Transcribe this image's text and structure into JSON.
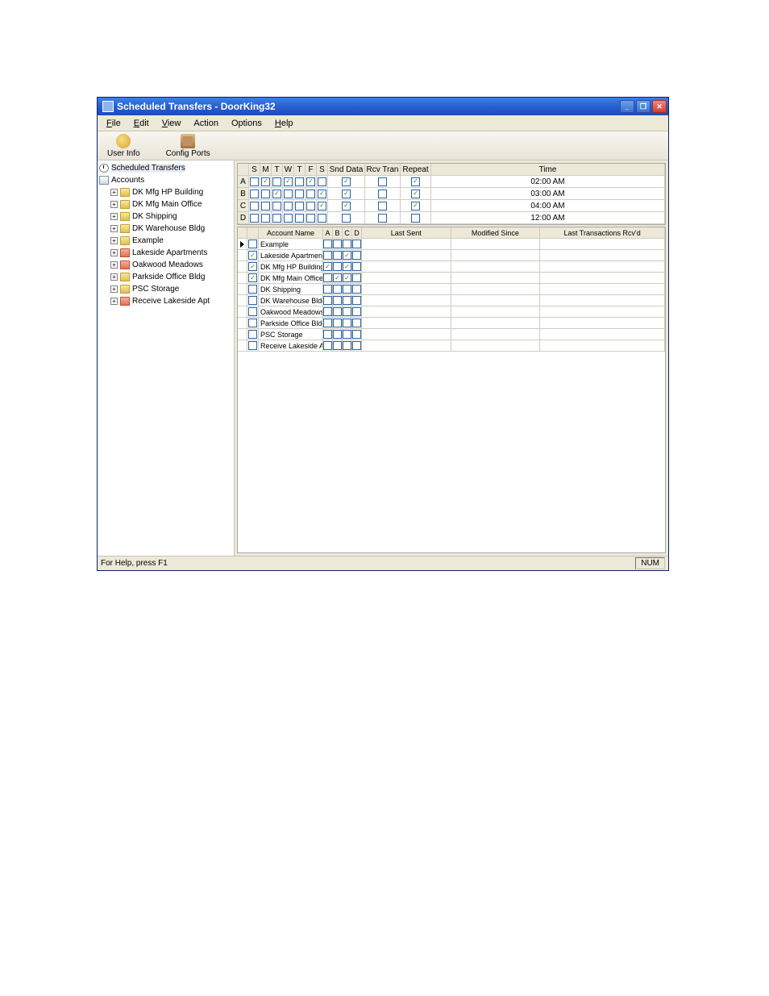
{
  "title": "Scheduled Transfers  - DoorKing32",
  "menu": [
    "File",
    "Edit",
    "View",
    "Action",
    "Options",
    "Help"
  ],
  "toolbar": {
    "userinfo": "User Info",
    "config": "Config Ports"
  },
  "tree": {
    "root1": "Scheduled Transfers",
    "root2": "Accounts",
    "items": [
      {
        "label": "DK Mfg HP Building",
        "color": "y"
      },
      {
        "label": "DK Mfg Main Office",
        "color": "y"
      },
      {
        "label": "DK Shipping",
        "color": "y"
      },
      {
        "label": "DK Warehouse Bldg",
        "color": "y"
      },
      {
        "label": "Example",
        "color": "y"
      },
      {
        "label": "Lakeside Apartments",
        "color": "r"
      },
      {
        "label": "Oakwood Meadows",
        "color": "r"
      },
      {
        "label": "Parkside Office Bldg",
        "color": "y"
      },
      {
        "label": "PSC Storage",
        "color": "y"
      },
      {
        "label": "Receive Lakeside Apt",
        "color": "r"
      }
    ]
  },
  "sched": {
    "headers": [
      "S",
      "M",
      "T",
      "W",
      "T",
      "F",
      "S",
      "Snd Data",
      "Rcv Tran",
      "Repeat",
      "Time"
    ],
    "rows": [
      {
        "lead": "A",
        "days": [
          0,
          1,
          0,
          1,
          0,
          1,
          0
        ],
        "snd": 1,
        "rcv": 0,
        "rep": 1,
        "time": "02:00 AM"
      },
      {
        "lead": "B",
        "days": [
          0,
          0,
          1,
          0,
          0,
          0,
          1
        ],
        "snd": 1,
        "rcv": 0,
        "rep": 1,
        "time": "03:00 AM"
      },
      {
        "lead": "C",
        "days": [
          0,
          0,
          0,
          0,
          0,
          0,
          1
        ],
        "snd": 1,
        "rcv": 0,
        "rep": 1,
        "time": "04:00 AM"
      },
      {
        "lead": "D",
        "days": [
          0,
          0,
          0,
          0,
          0,
          0,
          0
        ],
        "snd": 0,
        "rcv": 0,
        "rep": 0,
        "time": "12:00 AM"
      }
    ]
  },
  "accts": {
    "headers": [
      "",
      "",
      "Account Name",
      "A",
      "B",
      "C",
      "D",
      "Last Sent",
      "Modified Since",
      "Last Transactions Rcv'd"
    ],
    "rows": [
      {
        "sel": 1,
        "chk": 0,
        "name": "Example",
        "a": 0,
        "b": 0,
        "c": 0,
        "d": 0
      },
      {
        "sel": 0,
        "chk": 1,
        "name": "Lakeside Apartments",
        "a": 0,
        "b": 0,
        "c": 1,
        "d": 0
      },
      {
        "sel": 0,
        "chk": 1,
        "name": "DK Mfg HP Building",
        "a": 1,
        "b": 0,
        "c": 1,
        "d": 0
      },
      {
        "sel": 0,
        "chk": 1,
        "name": "DK Mfg Main Office",
        "a": 0,
        "b": 1,
        "c": 1,
        "d": 0
      },
      {
        "sel": 0,
        "chk": 0,
        "name": "DK Shipping",
        "a": 0,
        "b": 0,
        "c": 0,
        "d": 0
      },
      {
        "sel": 0,
        "chk": 0,
        "name": "DK Warehouse Bldg",
        "a": 0,
        "b": 0,
        "c": 0,
        "d": 0
      },
      {
        "sel": 0,
        "chk": 0,
        "name": "Oakwood Meadows",
        "a": 0,
        "b": 0,
        "c": 0,
        "d": 0
      },
      {
        "sel": 0,
        "chk": 0,
        "name": "Parkside Office Bldg",
        "a": 0,
        "b": 0,
        "c": 0,
        "d": 0
      },
      {
        "sel": 0,
        "chk": 0,
        "name": "PSC Storage",
        "a": 0,
        "b": 0,
        "c": 0,
        "d": 0
      },
      {
        "sel": 0,
        "chk": 0,
        "name": "Receive Lakeside Apt",
        "a": 0,
        "b": 0,
        "c": 0,
        "d": 0
      }
    ]
  },
  "status": {
    "left": "For Help, press F1",
    "right": "NUM"
  }
}
